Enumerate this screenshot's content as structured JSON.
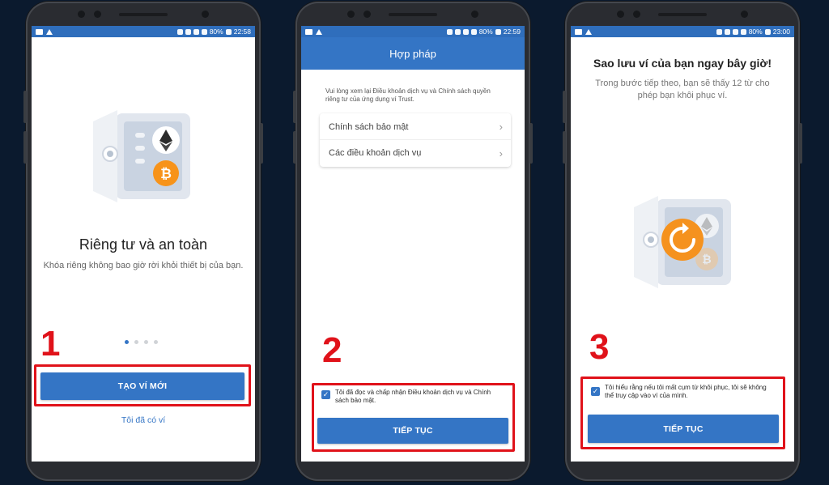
{
  "status_bars": [
    {
      "battery": "80%",
      "time": "22:58"
    },
    {
      "battery": "80%",
      "time": "22:59"
    },
    {
      "battery": "80%",
      "time": "23:00"
    }
  ],
  "screen1": {
    "title": "Riêng tư và an toàn",
    "subtitle": "Khóa riêng không bao giờ rời khỏi thiết bị của bạn.",
    "create_button": "TẠO VÍ MỚI",
    "have_wallet_link": "Tôi đã có ví",
    "pager_dots": 4,
    "step_number": "1"
  },
  "screen2": {
    "header_title": "Hợp pháp",
    "intro": "Vui lòng xem lại Điều khoản dịch vụ và Chính sách quyền riêng tư của ứng dụng ví Trust.",
    "items": [
      {
        "label": "Chính sách bảo mật"
      },
      {
        "label": "Các điều khoản dịch vụ"
      }
    ],
    "checkbox_text": "Tôi đã đọc và chấp nhận Điều khoản dịch vụ và Chính sách bảo mật.",
    "continue_button": "TIẾP TỤC",
    "step_number": "2"
  },
  "screen3": {
    "title": "Sao lưu ví của bạn ngay bây giờ!",
    "subtitle": "Trong bước tiếp theo, bạn sẽ thấy 12 từ cho phép bạn khôi phục ví.",
    "checkbox_text": "Tôi hiểu rằng nếu tôi mất cụm từ khôi phục, tôi sẽ không thể truy cập vào ví của mình.",
    "continue_button": "TIẾP TỤC",
    "step_number": "3"
  },
  "icons": {
    "safe": "safe-illustration-icon",
    "ethereum": "ethereum-icon",
    "bitcoin": "bitcoin-icon",
    "restore": "restore-icon",
    "checkbox": "checkbox-checked-icon",
    "chevron": "chevron-right-icon"
  },
  "colors": {
    "primary": "#3475c5",
    "highlight_red": "#e0121a",
    "bitcoin_orange": "#f7931a",
    "background": "#0b1a2e"
  }
}
